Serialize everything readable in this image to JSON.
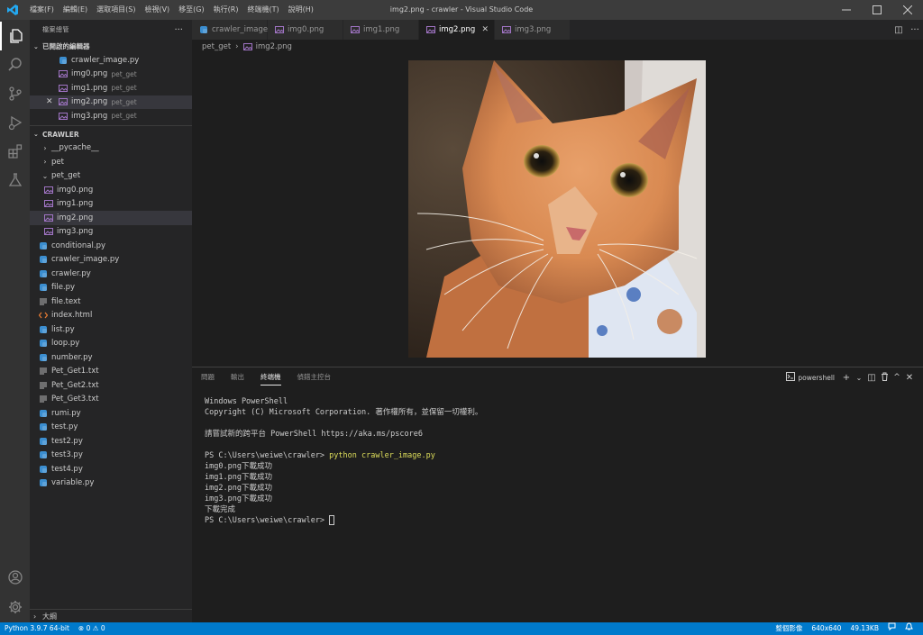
{
  "titlebar": {
    "title": "img2.png - crawler - Visual Studio Code",
    "menus": [
      "檔案(F)",
      "編輯(E)",
      "選取項目(S)",
      "檢視(V)",
      "移至(G)",
      "執行(R)",
      "終端機(T)",
      "說明(H)"
    ],
    "accent": "#3c3c3c"
  },
  "sidebar": {
    "header": "檔案總管",
    "open_editors_title": "已開啟的編輯器",
    "open_editors": [
      {
        "name": "crawler_image.py",
        "desc": "",
        "icon": "python-file-icon"
      },
      {
        "name": "img0.png",
        "desc": "pet_get",
        "icon": "image-file-icon"
      },
      {
        "name": "img1.png",
        "desc": "pet_get",
        "icon": "image-file-icon"
      },
      {
        "name": "img2.png",
        "desc": "pet_get",
        "icon": "image-file-icon"
      },
      {
        "name": "img3.png",
        "desc": "pet_get",
        "icon": "image-file-icon"
      }
    ],
    "folder_title": "CRAWLER",
    "folders": [
      "__pycache__",
      "pet",
      "pet_get"
    ],
    "pet_get_files": [
      "img0.png",
      "img1.png",
      "img2.png",
      "img3.png"
    ],
    "files": [
      "conditional.py",
      "crawler_image.py",
      "crawler.py",
      "file.py",
      "file.text",
      "index.html",
      "list.py",
      "loop.py",
      "number.py",
      "Pet_Get1.txt",
      "Pet_Get2.txt",
      "Pet_Get3.txt",
      "rumi.py",
      "test.py",
      "test2.py",
      "test3.py",
      "test4.py",
      "variable.py"
    ],
    "outline_title": "大綱"
  },
  "editor": {
    "tabs": [
      "crawler_image.py",
      "img0.png",
      "img1.png",
      "img2.png",
      "img3.png"
    ],
    "active_tab": "img2.png",
    "breadcrumb": [
      "pet_get",
      "img2.png"
    ]
  },
  "panel": {
    "tabs": [
      "問題",
      "輸出",
      "終端機",
      "偵錯主控台"
    ],
    "active_tab": "終端機",
    "shell": "powershell",
    "terminal": {
      "l1": "Windows PowerShell",
      "l2": "Copyright (C) Microsoft Corporation. 著作權所有，並保留一切權利。",
      "l3": "請嘗試新的跨平台 PowerShell https://aka.ms/pscore6",
      "prompt": "PS C:\\Users\\weiwe\\crawler> ",
      "command": "python crawler_image.py",
      "out1": "img0.png下載成功",
      "out2": "img1.png下載成功",
      "out3": "img2.png下載成功",
      "out4": "img3.png下載成功",
      "out5": "下載完成",
      "prompt2": "PS C:\\Users\\weiwe\\crawler> "
    }
  },
  "statusbar": {
    "python": "Python 3.9.7 64-bit",
    "problems": "0",
    "warnings": "0",
    "image_mode": "整個影像",
    "dimensions": "640x640",
    "size": "49.13KB"
  }
}
